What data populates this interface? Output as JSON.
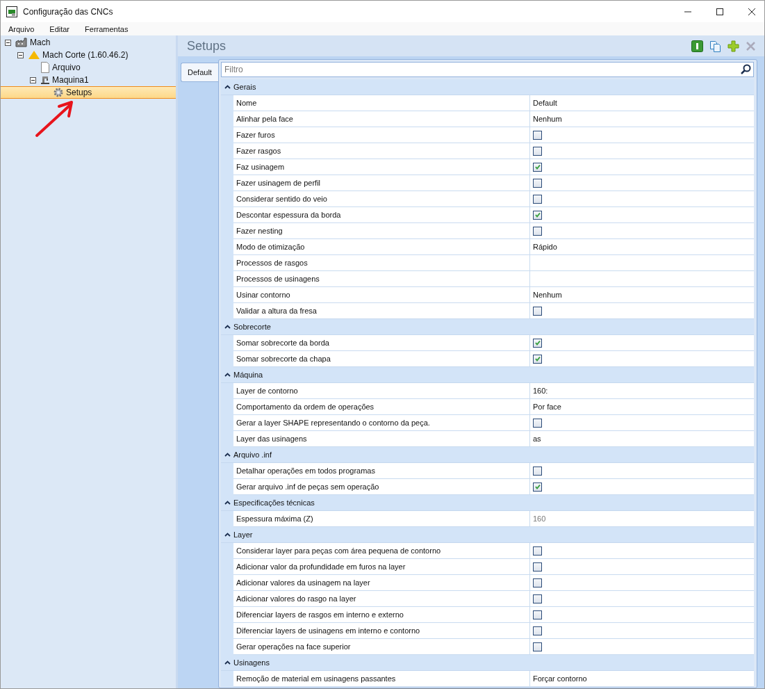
{
  "window": {
    "title": "Configuração das CNCs"
  },
  "menu": [
    "Arquivo",
    "Editar",
    "Ferramentas"
  ],
  "tree": [
    {
      "label": "Mach",
      "kind": "factory",
      "expanded": true,
      "selected": false,
      "children": [
        {
          "label": "Mach Corte (1.60.46.2)",
          "kind": "cone",
          "expanded": true,
          "selected": false,
          "children": [
            {
              "label": "Arquivo",
              "kind": "file",
              "selected": false
            },
            {
              "label": "Maquina1",
              "kind": "machine",
              "expanded": true,
              "selected": false,
              "children": [
                {
                  "label": "Setups",
                  "kind": "gear",
                  "selected": true
                }
              ]
            }
          ]
        }
      ]
    }
  ],
  "panel": {
    "title": "Setups"
  },
  "tabs": [
    {
      "label": "Default",
      "selected": true
    }
  ],
  "filter": {
    "placeholder": "Filtro"
  },
  "sections": [
    {
      "title": "Gerais",
      "expanded": true,
      "rows": [
        {
          "name": "Nome",
          "kind": "text",
          "value": "Default"
        },
        {
          "name": "Alinhar pela face",
          "kind": "text",
          "value": "Nenhum"
        },
        {
          "name": "Fazer furos",
          "kind": "checkbox",
          "checked": false
        },
        {
          "name": "Fazer rasgos",
          "kind": "checkbox",
          "checked": false
        },
        {
          "name": "Faz usinagem",
          "kind": "checkbox",
          "checked": true
        },
        {
          "name": "Fazer usinagem de perfil",
          "kind": "checkbox",
          "checked": false
        },
        {
          "name": "Considerar sentido do veio",
          "kind": "checkbox",
          "checked": false
        },
        {
          "name": "Descontar espessura da borda",
          "kind": "checkbox",
          "checked": true
        },
        {
          "name": "Fazer nesting",
          "kind": "checkbox",
          "checked": false
        },
        {
          "name": "Modo de otimização",
          "kind": "text",
          "value": "Rápido"
        },
        {
          "name": "Processos de rasgos",
          "kind": "empty"
        },
        {
          "name": "Processos de usinagens",
          "kind": "empty"
        },
        {
          "name": "Usinar contorno",
          "kind": "text",
          "value": "Nenhum"
        },
        {
          "name": "Validar a altura da fresa",
          "kind": "checkbox",
          "checked": false
        }
      ]
    },
    {
      "title": "Sobrecorte",
      "expanded": true,
      "rows": [
        {
          "name": "Somar sobrecorte da borda",
          "kind": "checkbox",
          "checked": true
        },
        {
          "name": "Somar sobrecorte da chapa",
          "kind": "checkbox",
          "checked": true
        }
      ]
    },
    {
      "title": "Máquina",
      "expanded": true,
      "rows": [
        {
          "name": "Layer de contorno",
          "kind": "text",
          "value": "160:"
        },
        {
          "name": "Comportamento da ordem de operações",
          "kind": "text",
          "value": "Por face"
        },
        {
          "name": "Gerar a layer SHAPE representando o contorno da peça.",
          "kind": "checkbox",
          "checked": false
        },
        {
          "name": "Layer das usinagens",
          "kind": "text",
          "value": "as"
        }
      ]
    },
    {
      "title": "Arquivo .inf",
      "expanded": true,
      "rows": [
        {
          "name": "Detalhar operações em todos programas",
          "kind": "checkbox",
          "checked": false
        },
        {
          "name": "Gerar arquivo .inf de peças sem operação",
          "kind": "checkbox",
          "checked": true
        }
      ]
    },
    {
      "title": "Especificações técnicas",
      "expanded": true,
      "rows": [
        {
          "name": "Espessura máxima (Z)",
          "kind": "readonly",
          "value": "160"
        }
      ]
    },
    {
      "title": "Layer",
      "expanded": true,
      "rows": [
        {
          "name": "Considerar layer para peças com área pequena de contorno",
          "kind": "checkbox",
          "checked": false
        },
        {
          "name": "Adicionar valor da profundidade em furos na layer",
          "kind": "checkbox",
          "checked": false
        },
        {
          "name": "Adicionar valores da usinagem na layer",
          "kind": "checkbox",
          "checked": false
        },
        {
          "name": "Adicionar valores do rasgo na layer",
          "kind": "checkbox",
          "checked": false
        },
        {
          "name": "Diferenciar layers de rasgos em interno e externo",
          "kind": "checkbox",
          "checked": false
        },
        {
          "name": "Diferenciar layers de usinagens em interno e contorno",
          "kind": "checkbox",
          "checked": false
        },
        {
          "name": "Gerar operações na face superior",
          "kind": "checkbox",
          "checked": false
        }
      ]
    },
    {
      "title": "Usinagens",
      "expanded": true,
      "rows": [
        {
          "name": "Remoção de material em usinagens passantes",
          "kind": "text",
          "value": "Forçar contorno"
        }
      ]
    }
  ]
}
